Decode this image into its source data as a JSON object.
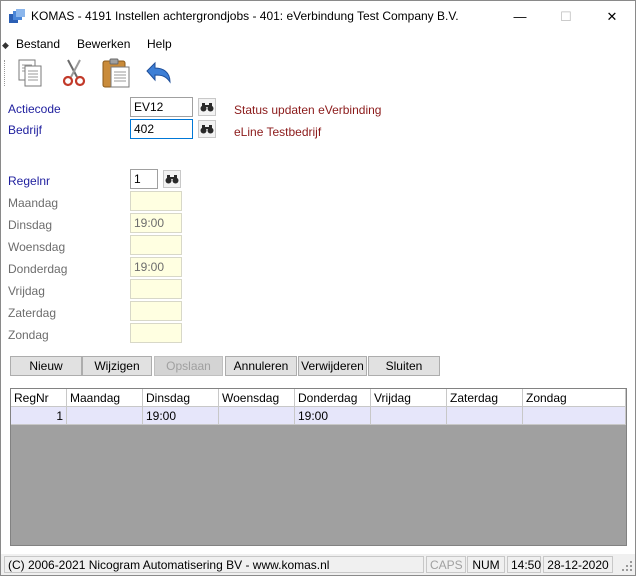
{
  "window": {
    "title": "KOMAS - 4191 Instellen achtergrondjobs - 401: eVerbindung Test Company B.V.",
    "minimize_glyph": "—",
    "maximize_glyph": "☐",
    "close_glyph": "✕"
  },
  "menu": {
    "items": [
      {
        "label": "Bestand"
      },
      {
        "label": "Bewerken"
      },
      {
        "label": "Help"
      }
    ]
  },
  "toolbar": {
    "icons": [
      "copy-icon",
      "cut-icon",
      "paste-icon",
      "undo-icon"
    ]
  },
  "form": {
    "actiecode": {
      "label": "Actiecode",
      "value": "EV12",
      "description": "Status updaten eVerbinding"
    },
    "bedrijf": {
      "label": "Bedrijf",
      "value": "402",
      "description": "eLine Testbedrijf"
    },
    "regelnr": {
      "label": "Regelnr",
      "value": "1"
    },
    "days": [
      {
        "label": "Maandag",
        "value": ""
      },
      {
        "label": "Dinsdag",
        "value": "19:00"
      },
      {
        "label": "Woensdag",
        "value": ""
      },
      {
        "label": "Donderdag",
        "value": "19:00"
      },
      {
        "label": "Vrijdag",
        "value": ""
      },
      {
        "label": "Zaterdag",
        "value": ""
      },
      {
        "label": "Zondag",
        "value": ""
      }
    ]
  },
  "buttons": {
    "nieuw": "Nieuw",
    "wijzigen": "Wijzigen",
    "opslaan": "Opslaan",
    "annuleren": "Annuleren",
    "verwijderen": "Verwijderen",
    "sluiten": "Sluiten"
  },
  "grid": {
    "columns": [
      "RegNr",
      "Maandag",
      "Dinsdag",
      "Woensdag",
      "Donderdag",
      "Vrijdag",
      "Zaterdag",
      "Zondag"
    ],
    "rows": [
      [
        "1",
        "",
        "19:00",
        "",
        "19:00",
        "",
        "",
        ""
      ]
    ]
  },
  "status": {
    "copyright": "(C) 2006-2021 Nicogram Automatisering BV - www.komas.nl",
    "caps": "CAPS",
    "num": "NUM",
    "time": "14:50",
    "date": "28-12-2020"
  },
  "colors": {
    "label_blue": "#1e1e9e",
    "description_red": "#8b1a1a",
    "readonly_yellow": "#ffffe1",
    "grid_selected_row": "#e6e6fa",
    "focus_border": "#0078d7"
  }
}
